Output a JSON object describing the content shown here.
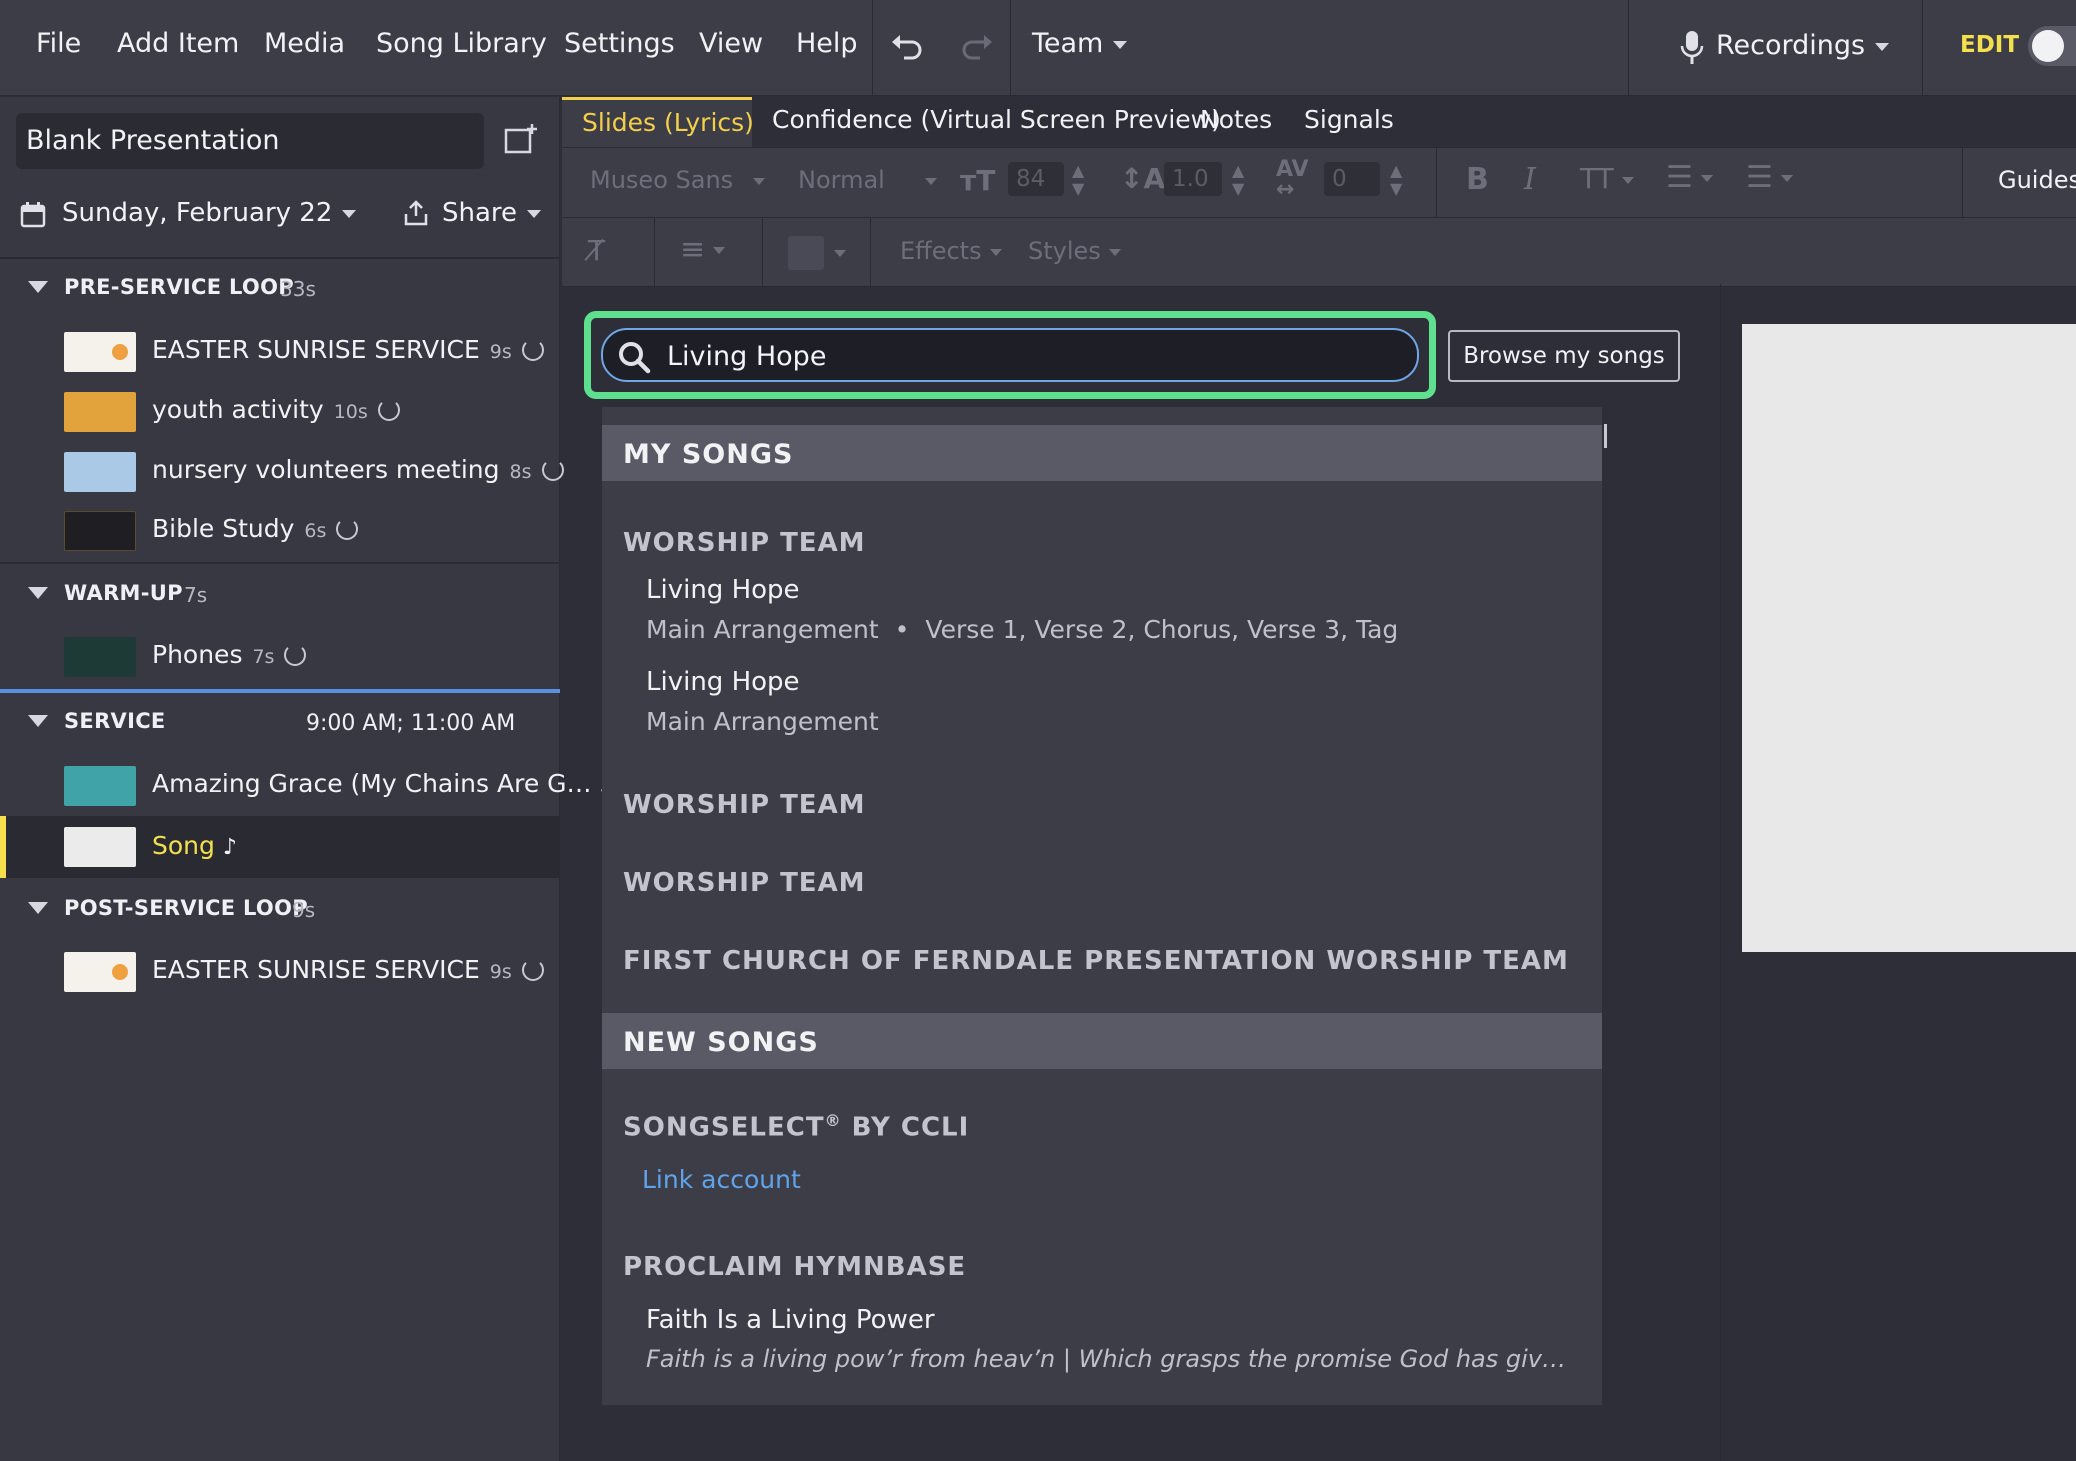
{
  "menubar": {
    "items": [
      "File",
      "Add Item",
      "Media",
      "Song Library",
      "Settings",
      "View",
      "Help"
    ],
    "team_label": "Team",
    "recordings_label": "Recordings",
    "edit_label": "EDIT"
  },
  "sidebar": {
    "presentation_title": "Blank Presentation",
    "date_label": "Sunday, February 22",
    "share_label": "Share",
    "sections": [
      {
        "name": "PRE-SERVICE LOOP",
        "duration": "33s",
        "items": [
          {
            "title": "EASTER SUNRISE SERVICE",
            "duration": "9s",
            "thumb_color": "#f4f2ea"
          },
          {
            "title": "youth activity",
            "duration": "10s",
            "thumb_color": "#e2a23c"
          },
          {
            "title": "nursery volunteers meeting",
            "duration": "8s",
            "thumb_color": "#a9c9e6"
          },
          {
            "title": "Bible Study",
            "duration": "6s",
            "thumb_color": "#1f1e22"
          }
        ]
      },
      {
        "name": "WARM-UP",
        "duration": "7s",
        "items": [
          {
            "title": "Phones",
            "duration": "7s",
            "thumb_color": "#1e3a36"
          }
        ]
      },
      {
        "name": "SERVICE",
        "duration": "9:00 AM; 11:00 AM",
        "items": [
          {
            "title": "Amazing Grace (My Chains Are G…",
            "duration": "",
            "thumb_color": "#3fa3a8"
          },
          {
            "title": "Song",
            "duration": "",
            "thumb_color": "#ebebeb"
          }
        ]
      },
      {
        "name": "POST-SERVICE LOOP",
        "duration": "9s",
        "items": [
          {
            "title": "EASTER SUNRISE SERVICE",
            "duration": "9s",
            "thumb_color": "#f4f2ea"
          }
        ]
      }
    ]
  },
  "tabs": [
    "Slides (Lyrics)",
    "Confidence (Virtual Screen Preview)",
    "Notes",
    "Signals"
  ],
  "toolbar": {
    "font": "Museo Sans",
    "weight": "Normal",
    "size": "84",
    "line_height": "1.0",
    "spacing": "0",
    "effects": "Effects",
    "styles": "Styles",
    "guides": "Guides"
  },
  "search": {
    "value": "Living Hope",
    "browse_label": "Browse my songs"
  },
  "dropdown": {
    "my_songs_header": "MY SONGS",
    "group_1": "WORSHIP TEAM",
    "song_1_title": "Living Hope",
    "song_1_arrangement": "Main Arrangement",
    "song_1_sequence": "Verse 1,  Verse 2,  Chorus,  Verse 3,  Tag",
    "song_2_title": "Living Hope",
    "song_2_arrangement": "Main Arrangement",
    "group_2": "WORSHIP TEAM",
    "group_3": "WORSHIP TEAM",
    "group_4": "FIRST CHURCH OF FERNDALE PRESENTATION WORSHIP TEAM",
    "new_songs_header": "NEW SONGS",
    "songselect": "SONGSELECT",
    "songselect_reg": "®",
    "songselect_by": " BY CCLI",
    "link_account": "Link account",
    "proclaim": "PROCLAIM HYMNBASE",
    "hymn_title": "Faith Is a Living Power",
    "hymn_snippet": "Faith is a living pow’r from heav’n | Which grasps the promise God has giv’n; | Sec…"
  },
  "colors": {
    "accent_green": "#5ee08f",
    "link_blue": "#5fa4ea",
    "active_yellow": "#f4e04d",
    "tab_active": "#f4d04a"
  }
}
